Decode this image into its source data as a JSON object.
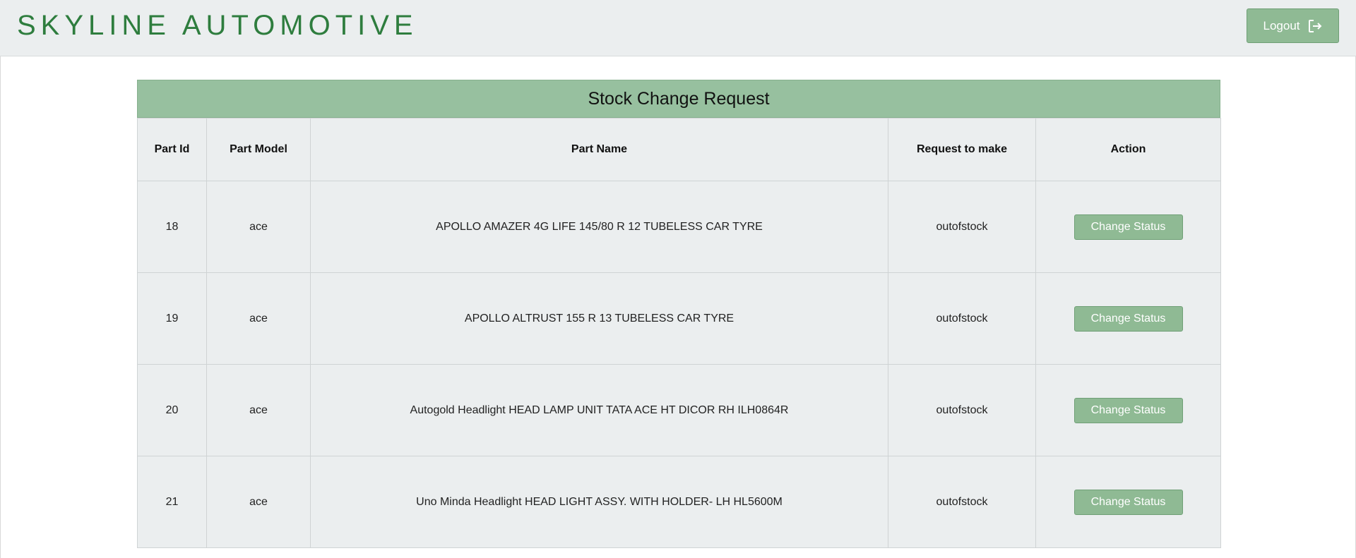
{
  "header": {
    "brand": "SKYLINE AUTOMOTIVE",
    "logout_label": "Logout"
  },
  "panel": {
    "title": "Stock Change Request",
    "columns": [
      "Part Id",
      "Part Model",
      "Part Name",
      "Request to make",
      "Action"
    ],
    "rows": [
      {
        "id": "18",
        "model": "ace",
        "name": "APOLLO AMAZER 4G LIFE 145/80 R 12 TUBELESS CAR TYRE",
        "request": "outofstock",
        "action": "Change Status"
      },
      {
        "id": "19",
        "model": "ace",
        "name": "APOLLO ALTRUST 155 R 13 TUBELESS CAR TYRE",
        "request": "outofstock",
        "action": "Change Status"
      },
      {
        "id": "20",
        "model": "ace",
        "name": "Autogold Headlight HEAD LAMP UNIT TATA ACE HT DICOR RH ILH0864R",
        "request": "outofstock",
        "action": "Change Status"
      },
      {
        "id": "21",
        "model": "ace",
        "name": "Uno Minda Headlight HEAD LIGHT ASSY. WITH HOLDER- LH HL5600M",
        "request": "outofstock",
        "action": "Change Status"
      }
    ]
  },
  "colors": {
    "brand": "#2e7d3e",
    "accent": "#8fba94",
    "title_bar": "#97c09f",
    "table_bg": "#ebeeef"
  }
}
